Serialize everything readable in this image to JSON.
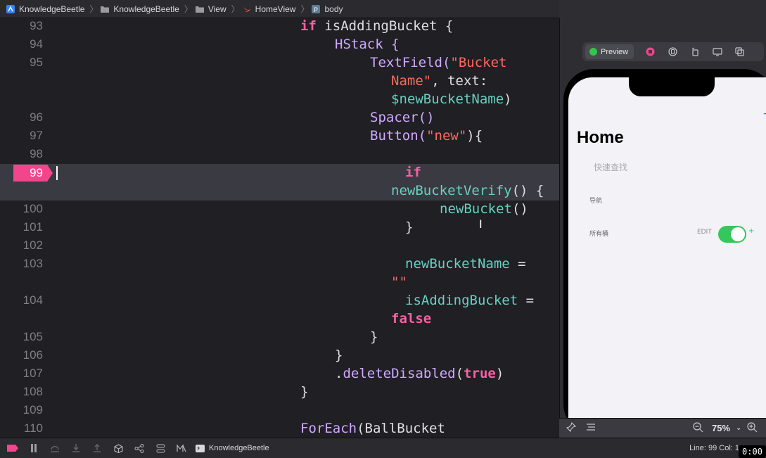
{
  "breadcrumb": {
    "items": [
      "KnowledgeBeetle",
      "KnowledgeBeetle",
      "View",
      "HomeView",
      "body"
    ]
  },
  "editor": {
    "current_line": "99",
    "line_numbers": [
      "93",
      "94",
      "95",
      "96",
      "97",
      "98",
      "99",
      "100",
      "101",
      "102",
      "103",
      "104",
      "105",
      "106",
      "107",
      "108",
      "109",
      "110"
    ],
    "code": {
      "l93_if": "if",
      "l93_rest": " isAddingBucket {",
      "l94": "HStack {",
      "l95_fn": "TextField(",
      "l95_str": "\"Bucket",
      "l95b_str": "Name\"",
      "l95b_rest": ", text:",
      "l95c_var": "$newBucketName",
      "l95c_rest": ")",
      "l96": "Spacer()",
      "l97_fn": "Button(",
      "l97_str": "\"new\"",
      "l97_rest": "){",
      "l99_if": "if",
      "l99b_var": "newBucketVerify",
      "l99b_rest": "() {",
      "l100_var": "newBucket",
      "l100_rest": "()",
      "l101": "}",
      "l103_var": "newBucketName",
      "l103_rest": " =",
      "l103b_str": "\"\"",
      "l104_var": "isAddingBucket",
      "l104_rest": " =",
      "l104b_kw": "false",
      "l105": "}",
      "l106": "}",
      "l107_dot": ".",
      "l107_fn": "deleteDisabled",
      "l107_p": "(",
      "l107_kw": "true",
      "l107_end": ")",
      "l108": "}",
      "l110_fn": "ForEach",
      "l110_rest": "(BallBucket"
    }
  },
  "preview": {
    "pill_label": "Preview",
    "home_title": "Home",
    "search_placeholder": "快速查找",
    "nav_label": "导航",
    "all_buckets_label": "所有桶",
    "edit_label": "EDIT",
    "add_symbol": "+",
    "toggle_on": true,
    "zoom": "75%"
  },
  "status": {
    "scheme": "KnowledgeBeetle",
    "line_col": "Line: 99  Col: 1",
    "timer": "0:00"
  },
  "colors": {
    "keyword": "#fc5fa3",
    "string": "#fc6a5d",
    "function": "#d0a8ff",
    "variable": "#67d1c0",
    "breakpoint": "#f1468b",
    "toggle": "#34c759"
  }
}
